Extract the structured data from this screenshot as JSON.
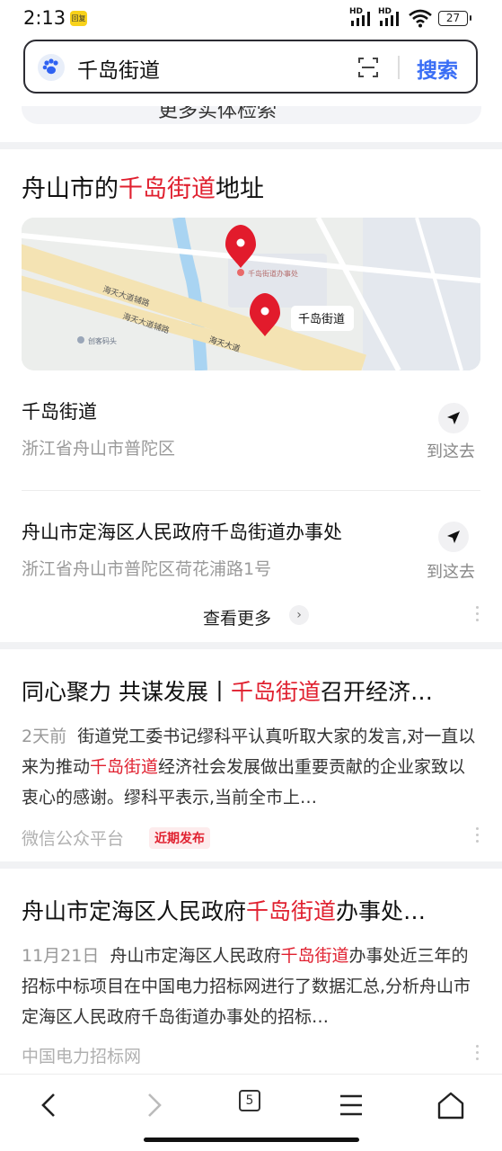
{
  "status_bar": {
    "time": "2:13",
    "badge": "回复",
    "hd1": "HD",
    "hd2": "HD",
    "battery": "27"
  },
  "search": {
    "query": "千岛街道",
    "button": "搜索"
  },
  "partial_card": {
    "text": "更多实体检索"
  },
  "address_card": {
    "title_prefix": "舟山市的",
    "title_highlight": "千岛街道",
    "title_suffix": "地址",
    "map": {
      "road1": "海天大道辅路",
      "road2": "海天大道辅路",
      "road3": "海天大道",
      "poi_small": "千岛街道办事处",
      "poi_creative": "创客码头",
      "pin_label": "千岛街道"
    },
    "items": [
      {
        "name": "千岛街道",
        "address": "浙江省舟山市普陀区",
        "action": "到这去"
      },
      {
        "name": "舟山市定海区人民政府千岛街道办事处",
        "address": "浙江省舟山市普陀区荷花浦路1号",
        "action": "到这去"
      }
    ],
    "more": "查看更多"
  },
  "news": [
    {
      "title_pre": "同心聚力 共谋发展丨",
      "title_hl": "千岛街道",
      "title_post": "召开经济…",
      "date": "2天前",
      "body_pre": "街道党工委书记缪科平认真听取大家的发言,对一直以来为推动",
      "body_hl": "千岛街道",
      "body_post": "经济社会发展做出重要贡献的企业家致以衷心的感谢。缪科平表示,当前全市上…",
      "source": "微信公众平台",
      "tag": "近期发布"
    },
    {
      "title_pre": "舟山市定海区人民政府",
      "title_hl": "千岛街道",
      "title_post": "办事处…",
      "date": "11月21日",
      "body_pre": "舟山市定海区人民政府",
      "body_hl": "千岛街道",
      "body_post": "办事处近三年的招标中标项目在中国电力招标网进行了数据汇总,分析舟山市定海区人民政府千岛街道办事处的招标…",
      "source": "中国电力招标网"
    }
  ],
  "bottom_nav": {
    "tabs": "5"
  }
}
